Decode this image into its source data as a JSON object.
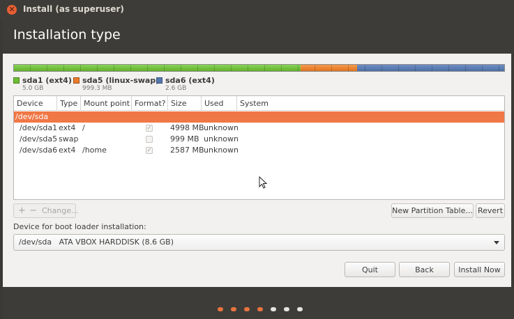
{
  "window": {
    "title": "Install (as superuser)",
    "close_icon": "close-icon"
  },
  "page": {
    "title": "Installation type"
  },
  "partition_bar": {
    "segments": [
      {
        "name": "sda1 (ext4)",
        "size": "5.0 GB",
        "color": "#6cbd33",
        "fraction": 0.584
      },
      {
        "name": "sda5 (linux-swap)",
        "size": "999.3 MB",
        "color": "#e97b2a",
        "fraction": 0.116
      },
      {
        "name": "sda6 (ext4)",
        "size": "2.6 GB",
        "color": "#5577ae",
        "fraction": 0.3
      }
    ]
  },
  "table": {
    "columns": [
      "Device",
      "Type",
      "Mount point",
      "Format?",
      "Size",
      "Used",
      "System"
    ],
    "rows": [
      {
        "device": "/dev/sda",
        "type": "",
        "mount": "",
        "format": null,
        "size": "",
        "used": "",
        "system": "",
        "selected": true
      },
      {
        "device": "/dev/sda1",
        "type": "ext4",
        "mount": "/",
        "format": true,
        "size": "4998 MB",
        "used": "unknown",
        "system": "",
        "selected": false
      },
      {
        "device": "/dev/sda5",
        "type": "swap",
        "mount": "",
        "format": false,
        "size": "999 MB",
        "used": "unknown",
        "system": "",
        "selected": false
      },
      {
        "device": "/dev/sda6",
        "type": "ext4",
        "mount": "/home",
        "format": true,
        "size": "2587 MB",
        "used": "unknown",
        "system": "",
        "selected": false
      }
    ]
  },
  "toolbar": {
    "add_label": "+",
    "remove_label": "−",
    "change_label": "Change...",
    "new_table_label": "New Partition Table...",
    "revert_label": "Revert"
  },
  "bootloader": {
    "label": "Device for boot loader installation:",
    "selected": "/dev/sda   ATA VBOX HARDDISK (8.6 GB)"
  },
  "buttons": {
    "quit": "Quit",
    "back": "Back",
    "install": "Install Now"
  },
  "progress": {
    "total_steps": 7,
    "completed_steps": 4
  },
  "colors": {
    "accent": "#f07746",
    "chrome": "#3e3c38"
  }
}
